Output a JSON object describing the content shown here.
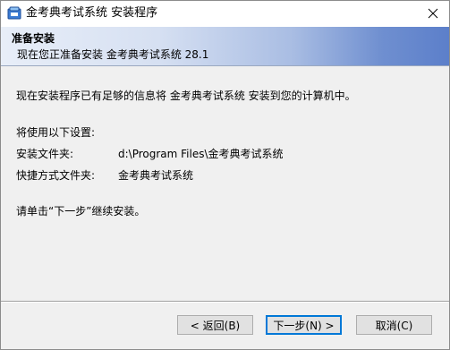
{
  "window": {
    "title": "金考典考试系统 安装程序",
    "icon": "installer-icon"
  },
  "banner": {
    "title": "准备安装",
    "subtitle": "现在您正准备安装 金考典考试系统 28.1"
  },
  "content": {
    "intro": "现在安装程序已有足够的信息将 金考典考试系统 安装到您的计算机中。",
    "settings_heading": "将使用以下设置:",
    "install_folder_label": "安装文件夹:",
    "install_folder_value": "d:\\Program Files\\金考典考试系统",
    "shortcut_folder_label": "快捷方式文件夹:",
    "shortcut_folder_value": "金考典考试系统",
    "instruction": "请单击“下一步”继续安装。"
  },
  "buttons": {
    "back": "< 返回(B)",
    "next": "下一步(N) >",
    "cancel": "取消(C)"
  },
  "colors": {
    "banner_end": "#5c7fca",
    "content_bg": "#f0f0f0",
    "default_button_border": "#0078d7"
  }
}
